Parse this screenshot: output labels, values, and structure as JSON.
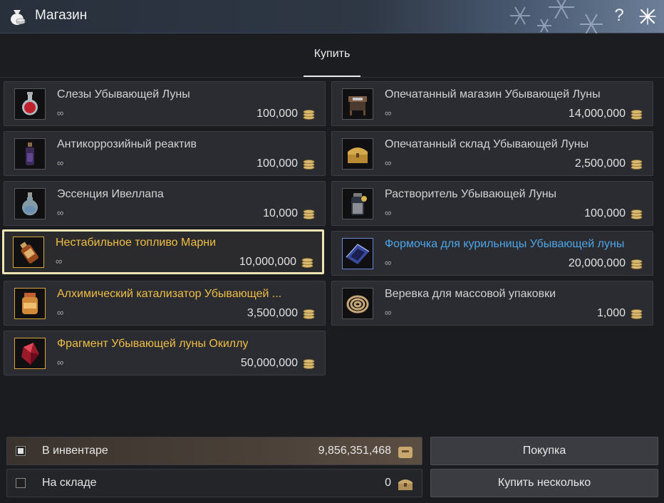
{
  "window": {
    "title": "Магазин",
    "help_label": "?"
  },
  "tabs": [
    {
      "label": "Купить"
    }
  ],
  "items": [
    {
      "name": "Слезы Убывающей Луны",
      "stock": "∞",
      "price": "100,000",
      "icon": "potion-flask-icon",
      "name_color": "default"
    },
    {
      "name": "Опечатанный магазин Убывающей Луны",
      "stock": "∞",
      "price": "14,000,000",
      "icon": "shop-stall-icon",
      "name_color": "default"
    },
    {
      "name": "Антикоррозийный реактив",
      "stock": "∞",
      "price": "100,000",
      "icon": "reagent-bottle-icon",
      "name_color": "default"
    },
    {
      "name": "Опечатанный склад Убывающей Луны",
      "stock": "∞",
      "price": "2,500,000",
      "icon": "treasure-chest-icon",
      "name_color": "default"
    },
    {
      "name": "Эссенция Ивеллапа",
      "stock": "∞",
      "price": "10,000",
      "icon": "essence-flask-icon",
      "name_color": "default"
    },
    {
      "name": "Растворитель Убывающей Луны",
      "stock": "∞",
      "price": "100,000",
      "icon": "solvent-jar-icon",
      "name_color": "default"
    },
    {
      "name": "Нестабильное топливо Марни",
      "stock": "∞",
      "price": "10,000,000",
      "icon": "fuel-bottle-icon",
      "name_color": "yellow"
    },
    {
      "name": "Формочка для курильницы Убывающей луны",
      "stock": "∞",
      "price": "20,000,000",
      "icon": "incense-mold-icon",
      "name_color": "blue"
    },
    {
      "name": "Алхимический катализатор Убывающей ...",
      "stock": "∞",
      "price": "3,500,000",
      "icon": "catalyst-jar-icon",
      "name_color": "yellow"
    },
    {
      "name": "Веревка для массовой упаковки",
      "stock": "∞",
      "price": "1,000",
      "icon": "rope-coil-icon",
      "name_color": "default"
    },
    {
      "name": "Фрагмент Убывающей луны Окиллу",
      "stock": "∞",
      "price": "50,000,000",
      "icon": "red-crystal-icon",
      "name_color": "yellow"
    }
  ],
  "selected_item": "Нестабильное топливо Марни",
  "payment": {
    "inventory": {
      "label": "В инвентаре",
      "amount": "9,856,351,468",
      "checked": true
    },
    "storage": {
      "label": "На складе",
      "amount": "0",
      "checked": false
    }
  },
  "buttons": {
    "buy": "Покупка",
    "buy_multiple": "Купить несколько"
  },
  "colors": {
    "yellow_name": "#f0be45",
    "blue_name": "#4ea6e8",
    "selection_border": "#efe4b4"
  }
}
